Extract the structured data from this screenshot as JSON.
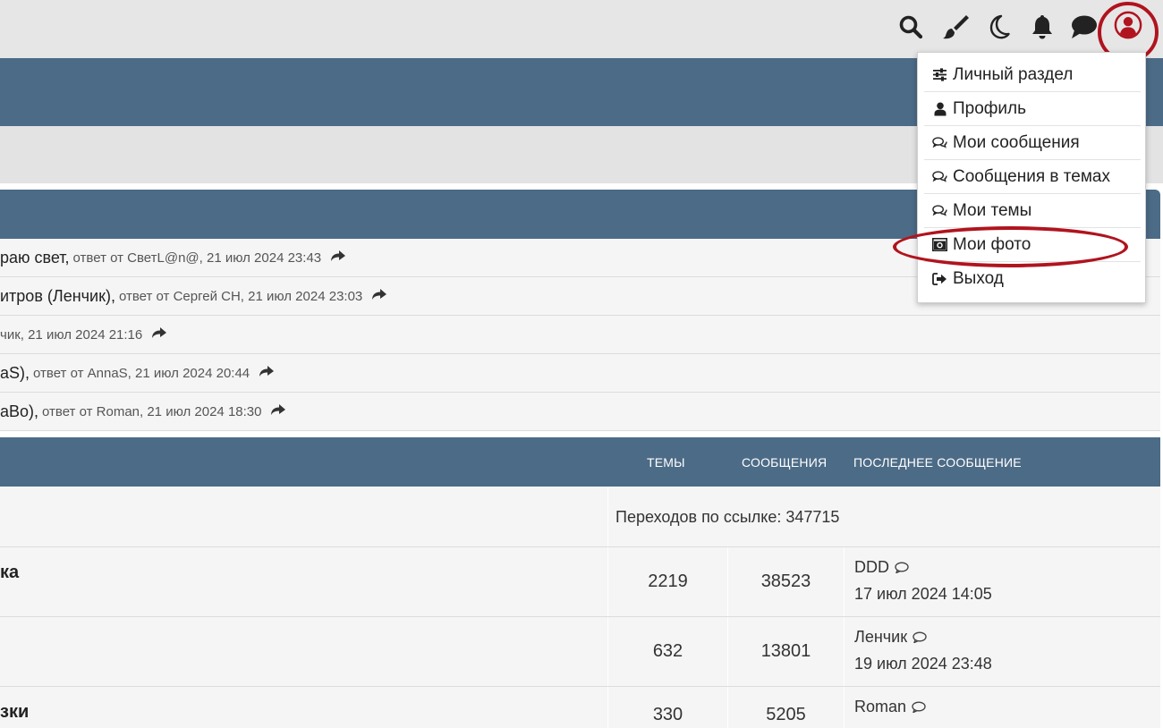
{
  "topbar": {
    "icons": [
      "search-icon",
      "brush-icon",
      "moon-icon",
      "bell-icon",
      "chat-icon",
      "user-circle-icon"
    ],
    "accent": "#b0141e"
  },
  "recent_posts": [
    {
      "title": "раю свет,",
      "meta": "ответ от СветL@n@, 21 июл 2024 23:43"
    },
    {
      "title": "итров (Ленчик),",
      "meta": "ответ от Сергей СН, 21 июл 2024 23:03"
    },
    {
      "title": "",
      "meta": "чик, 21 июл 2024 21:16"
    },
    {
      "title": "aS),",
      "meta": "ответ от AnnaS, 21 июл 2024 20:44"
    },
    {
      "title": "aBo),",
      "meta": "ответ от Roman, 21 июл 2024 18:30"
    }
  ],
  "table": {
    "headers": {
      "topics": "ТЕМЫ",
      "messages": "СООБЩЕНИЯ",
      "last": "ПОСЛЕДНЕЕ СООБЩЕНИЕ"
    },
    "redirect_text": "Переходов по ссылке: 347715",
    "rows": [
      {
        "name": "ка",
        "topics": "2219",
        "messages": "38523",
        "last_user": "DDD",
        "last_date": "17 июл 2024 14:05"
      },
      {
        "name": "",
        "topics": "632",
        "messages": "13801",
        "last_user": "Ленчик",
        "last_date": "19 июл 2024 23:48"
      },
      {
        "name": "зки",
        "topics": "330",
        "messages": "5205",
        "last_user": "Roman",
        "last_date": ""
      }
    ]
  },
  "user_menu": {
    "items": [
      {
        "label": "Личный раздел",
        "icon": "sliders-icon"
      },
      {
        "label": "Профиль",
        "icon": "user-icon"
      },
      {
        "label": "Мои сообщения",
        "icon": "comments-icon"
      },
      {
        "label": "Сообщения в темах",
        "icon": "comments-icon"
      },
      {
        "label": "Мои темы",
        "icon": "comments-icon"
      },
      {
        "label": "Мои фото",
        "icon": "camera-icon"
      },
      {
        "label": "Выход",
        "icon": "sign-out-icon"
      }
    ]
  },
  "colors": {
    "header": "#4c6b86",
    "highlight_ring": "#b0141e"
  }
}
